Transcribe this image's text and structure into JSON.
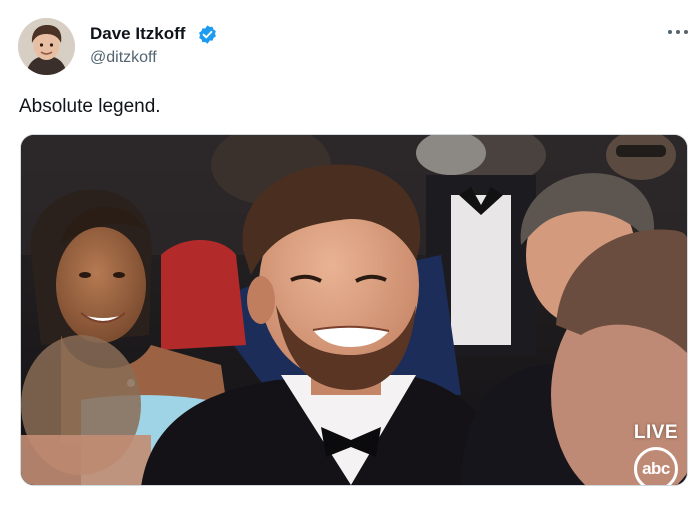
{
  "author": {
    "display_name": "Dave Itzkoff",
    "handle": "@ditzkoff",
    "verified": true,
    "avatar_icon": "profile-photo"
  },
  "tweet": {
    "text": "Absolute legend."
  },
  "media": {
    "overlay": {
      "live_label": "LIVE",
      "network_logo": "abc"
    }
  },
  "colors": {
    "verified_blue": "#1d9bf0",
    "secondary_text": "#536471",
    "primary_text": "#0f1419"
  }
}
